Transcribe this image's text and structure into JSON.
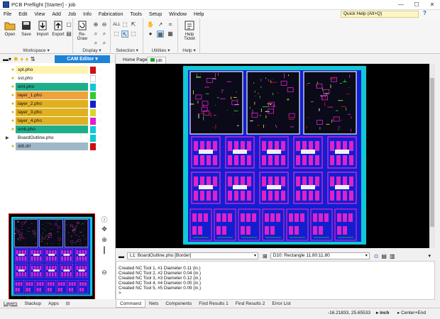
{
  "window": {
    "title": "PCB Preflight [Starter] - job",
    "minimize": "—",
    "maximize": "☐",
    "close": "✕"
  },
  "menu": [
    "File",
    "Edit",
    "View",
    "Add",
    "Job",
    "Info",
    "Fabrication",
    "Tools",
    "Setup",
    "Window",
    "Help"
  ],
  "quick_help": "Quick Help (Alt+Q)",
  "ribbon": {
    "groups": [
      {
        "label": "Workspace",
        "buttons": [
          "Open",
          "Save",
          "Import",
          "Export"
        ]
      },
      {
        "label": "Display",
        "buttons": [
          "Re-Draw"
        ]
      },
      {
        "label": "Selection",
        "buttons": []
      },
      {
        "label": "Utilities",
        "buttons": []
      },
      {
        "label": "Help",
        "buttons": [
          "Help Ticket"
        ]
      }
    ]
  },
  "left_panel": {
    "cam_editor": "CAM Editor",
    "layers": [
      {
        "name": "spt.pho",
        "bg": "#fff3b0",
        "swatch": "#cc1111",
        "bulb": true,
        "expand": false
      },
      {
        "name": "sst.pho",
        "bg": "#ffffff",
        "swatch": "#ffffff",
        "bulb": true,
        "expand": false
      },
      {
        "name": "smt.pho",
        "bg": "#1fae8a",
        "swatch": "#11c8d6",
        "bulb": true,
        "expand": false
      },
      {
        "name": "layer_1.pho",
        "bg": "#f0a23a",
        "swatch": "#2ecc2e",
        "bulb": true,
        "expand": false
      },
      {
        "name": "layer_2.pho",
        "bg": "#e0b020",
        "swatch": "#1020d0",
        "bulb": true,
        "expand": false
      },
      {
        "name": "layer_3.pho",
        "bg": "#e0b020",
        "swatch": "#d6d62a",
        "bulb": true,
        "expand": false
      },
      {
        "name": "layer_4.pho",
        "bg": "#e0b020",
        "swatch": "#dd22cc",
        "bulb": true,
        "expand": false
      },
      {
        "name": "smb.pho",
        "bg": "#1fae8a",
        "swatch": "#11c8d6",
        "bulb": true,
        "expand": false
      },
      {
        "name": "BoardOutline.pho",
        "bg": "#ffffff",
        "swatch": "#11c8d6",
        "bulb": false,
        "expand": true
      },
      {
        "name": "ddt.drl",
        "bg": "#9fb8c8",
        "swatch": "#cc1111",
        "bulb": true,
        "expand": false
      }
    ],
    "tabs": [
      "Layers",
      "Stackup",
      "Apps"
    ]
  },
  "doc_tabs": [
    "Home Page",
    "job"
  ],
  "selection_bar": {
    "layer": "L1: BoardOutline.pho [Border]",
    "dcode": "D10: Rectangle 11.80:11.80"
  },
  "log_lines": [
    "Created NC Tool 1, #1  Diameter 0.11 (in.)",
    "Created NC Tool 2, #2  Diameter 0.04 (in.)",
    "Created NC Tool 3, #3  Diameter 0.12 (in.)",
    "Created NC Tool 4, #4  Diameter 0.05 (in.)",
    "Created NC Tool 5, #5  Diameter 0.09 (in.)",
    ">"
  ],
  "bottom_tabs": [
    "Command",
    "Nets",
    "Components",
    "Find Results 1",
    "Find Results 2",
    "Error List"
  ],
  "status": {
    "coords": "-16.21833, 25.65533",
    "units": "inch",
    "snap": "Center+End"
  }
}
